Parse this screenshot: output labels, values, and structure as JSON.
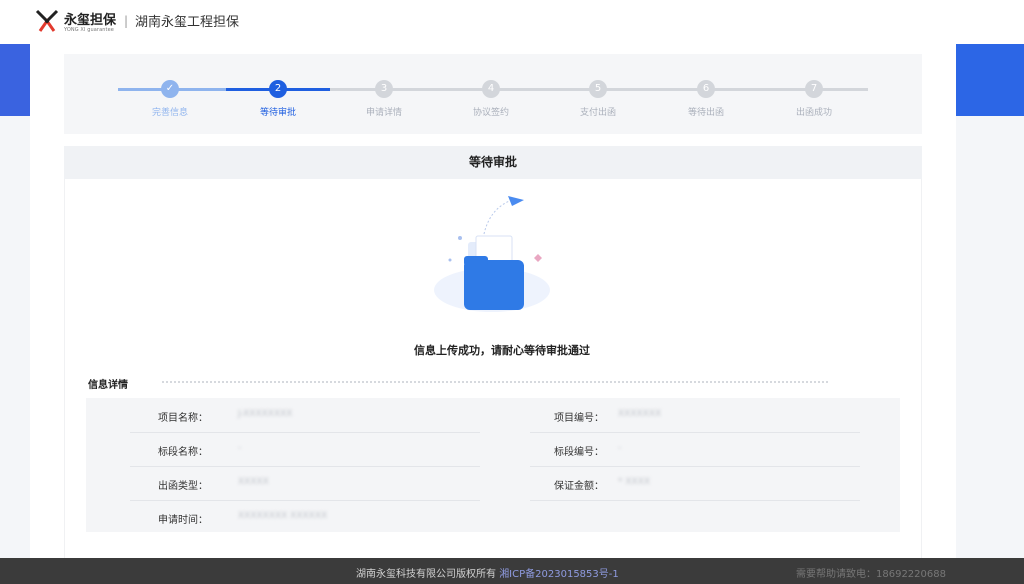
{
  "header": {
    "brand": "永玺担保",
    "brand_sub": "YONG XI guarantee",
    "separator": "|",
    "company": "湖南永玺工程担保"
  },
  "steps": [
    {
      "num": "✓",
      "label": "完善信息",
      "state": "done"
    },
    {
      "num": "2",
      "label": "等待审批",
      "state": "active"
    },
    {
      "num": "3",
      "label": "申请详情",
      "state": "todo"
    },
    {
      "num": "4",
      "label": "协议签约",
      "state": "todo"
    },
    {
      "num": "5",
      "label": "支付出函",
      "state": "todo"
    },
    {
      "num": "6",
      "label": "等待出函",
      "state": "todo"
    },
    {
      "num": "7",
      "label": "出函成功",
      "state": "todo"
    }
  ],
  "panel": {
    "title": "等待审批",
    "success_message": "信息上传成功，请耐心等待审批通过"
  },
  "info": {
    "title": "信息详情",
    "fields": {
      "project_name": {
        "label": "项目名称：",
        "value": "J-XXXXXXXX"
      },
      "project_no": {
        "label": "项目编号：",
        "value": "XXXXXXX"
      },
      "section_name": {
        "label": "标段名称：",
        "value": "-"
      },
      "section_no": {
        "label": "标段编号：",
        "value": "-"
      },
      "letter_type": {
        "label": "出函类型：",
        "value": "XXXXX"
      },
      "guarantee_amount": {
        "label": "保证金额：",
        "value": "* XXXX"
      },
      "apply_time": {
        "label": "申请时间：",
        "value": "XXXXXXXX XXXXXX"
      }
    }
  },
  "footer": {
    "copyright": "湖南永玺科技有限公司版权所有",
    "icp": "湘ICP备2023015853号-1",
    "help": "需要帮助请致电：18692220688"
  },
  "colors": {
    "primary": "#1f5fe0",
    "done": "#8fb4ee",
    "todo": "#d3d6db"
  }
}
